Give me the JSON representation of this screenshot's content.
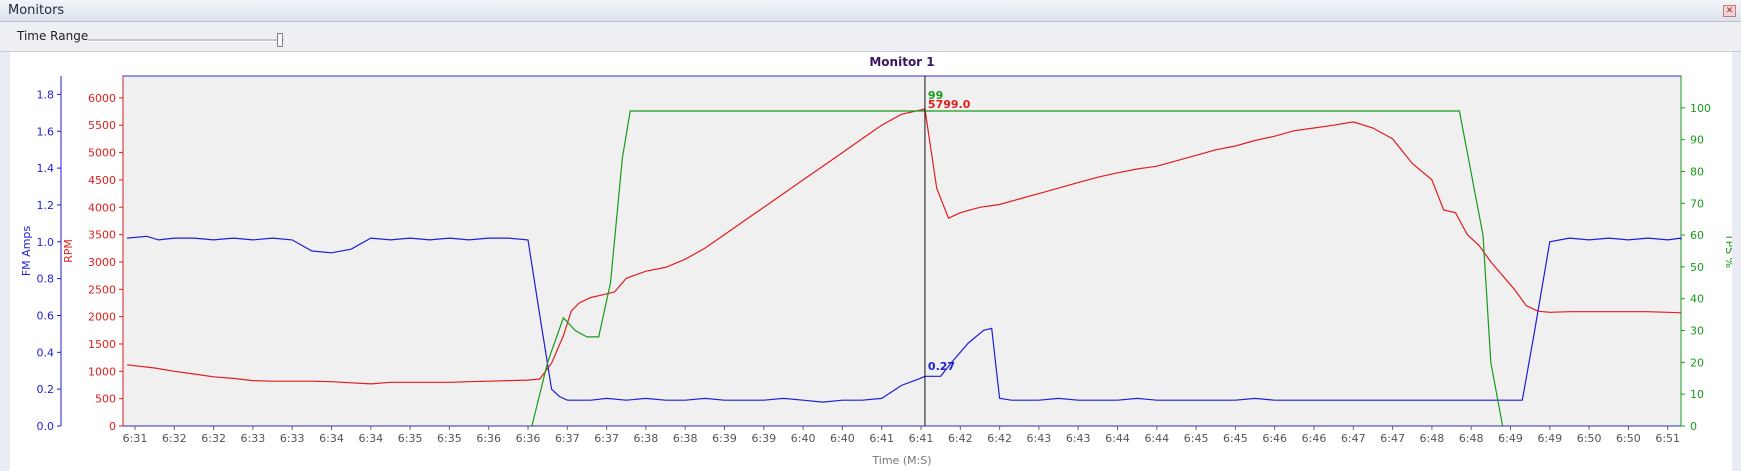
{
  "window": {
    "title": "Monitors",
    "close_icon": "close-icon"
  },
  "toolbar": {
    "time_range_label": "Time Range",
    "time_range_level": 1.0
  },
  "chart_data": {
    "type": "line",
    "title": "Monitor 1",
    "xlabel": "Time (M:S)",
    "x_ticks": [
      "6:31",
      "6:32",
      "6:32",
      "6:33",
      "6:33",
      "6:34",
      "6:34",
      "6:35",
      "6:35",
      "6:36",
      "6:36",
      "6:37",
      "6:37",
      "6:38",
      "6:38",
      "6:39",
      "6:39",
      "6:40",
      "6:40",
      "6:41",
      "6:41",
      "6:42",
      "6:42",
      "6:43",
      "6:43",
      "6:44",
      "6:44",
      "6:45",
      "6:45",
      "6:46",
      "6:46",
      "6:47",
      "6:47",
      "6:48",
      "6:48",
      "6:49",
      "6:49",
      "6:50",
      "6:50",
      "6:51"
    ],
    "grid": false,
    "axes": [
      {
        "id": "amps",
        "label": "FM Amps",
        "color": "#1f1fd6",
        "side": "left",
        "range": [
          0,
          1.9
        ],
        "ticks": [
          "0.0",
          "0.2",
          "0.4",
          "0.6",
          "0.8",
          "1.0",
          "1.2",
          "1.4",
          "1.6",
          "1.8"
        ]
      },
      {
        "id": "rpm",
        "label": "RPM",
        "color": "#e01e1e",
        "side": "left",
        "range": [
          0,
          6400
        ],
        "ticks": [
          "0",
          "500",
          "1000",
          "1500",
          "2000",
          "2500",
          "3000",
          "3500",
          "4000",
          "4500",
          "5000",
          "5500",
          "6000"
        ]
      },
      {
        "id": "tps",
        "label": "TPS %",
        "color": "#1a9a1a",
        "side": "right",
        "range": [
          0,
          110
        ],
        "ticks": [
          "0",
          "10",
          "20",
          "30",
          "40",
          "50",
          "60",
          "70",
          "80",
          "90",
          "100"
        ]
      }
    ],
    "cursor": {
      "x_tick_index": 20.1,
      "labels": [
        {
          "series": "TPS %",
          "text": "99",
          "color": "#1a9a1a"
        },
        {
          "series": "RPM",
          "text": "5799.0",
          "color": "#e01e1e"
        },
        {
          "series": "FM Amps",
          "text": "0.27",
          "color": "#1f1fd6"
        }
      ]
    },
    "series": [
      {
        "name": "RPM",
        "axis": "rpm",
        "color": "#e01e1e",
        "x": [
          -0.2,
          0.5,
          1,
          1.5,
          2,
          2.5,
          3,
          3.5,
          4,
          4.5,
          5,
          5.5,
          6,
          6.5,
          7,
          7.5,
          8,
          8.5,
          9,
          9.5,
          10,
          10.3,
          10.6,
          10.9,
          11.1,
          11.3,
          11.6,
          11.9,
          12.2,
          12.5,
          13,
          13.5,
          14,
          14.5,
          15,
          15.5,
          16,
          16.5,
          17,
          17.5,
          18,
          18.5,
          19,
          19.5,
          20,
          20.1,
          20.4,
          20.7,
          21,
          21.5,
          22,
          22.5,
          23,
          23.5,
          24,
          24.5,
          25,
          25.5,
          26,
          26.5,
          27,
          27.5,
          28,
          28.5,
          29,
          29.5,
          30,
          30.5,
          31,
          31.5,
          32,
          32.5,
          33,
          33.3,
          33.6,
          33.9,
          34.2,
          34.5,
          34.8,
          35.1,
          35.4,
          35.7,
          36,
          36.5,
          37,
          37.5,
          38,
          38.5,
          39,
          39.5,
          39.9
        ],
        "y": [
          1120,
          1060,
          1000,
          950,
          900,
          870,
          830,
          820,
          820,
          820,
          810,
          790,
          770,
          800,
          800,
          800,
          800,
          810,
          820,
          830,
          840,
          860,
          1150,
          1650,
          2100,
          2250,
          2350,
          2400,
          2450,
          2700,
          2830,
          2900,
          3050,
          3250,
          3500,
          3750,
          4000,
          4250,
          4500,
          4750,
          5000,
          5250,
          5500,
          5700,
          5780,
          5799,
          4350,
          3800,
          3900,
          4000,
          4050,
          4150,
          4250,
          4350,
          4450,
          4550,
          4630,
          4700,
          4750,
          4850,
          4950,
          5050,
          5120,
          5220,
          5300,
          5400,
          5450,
          5500,
          5560,
          5450,
          5250,
          4800,
          4500,
          3950,
          3900,
          3500,
          3300,
          3000,
          2750,
          2500,
          2200,
          2100,
          2080,
          2090,
          2090,
          2090,
          2090,
          2090,
          2080,
          2070,
          2070
        ]
      },
      {
        "name": "FM Amps",
        "axis": "amps",
        "color": "#1f1fd6",
        "x": [
          -0.2,
          0.3,
          0.6,
          1,
          1.5,
          2,
          2.5,
          3,
          3.5,
          4,
          4.5,
          5,
          5.5,
          6,
          6.5,
          7,
          7.5,
          8,
          8.5,
          9,
          9.5,
          10,
          10.3,
          10.6,
          10.8,
          11,
          11.3,
          11.6,
          12,
          12.5,
          13,
          13.5,
          14,
          14.5,
          15,
          15.5,
          16,
          16.5,
          17,
          17.5,
          18,
          18.5,
          19,
          19.5,
          20,
          20.1,
          20.5,
          20.8,
          21.2,
          21.6,
          21.8,
          22,
          22.3,
          22.6,
          23,
          23.5,
          24,
          24.5,
          25,
          25.5,
          26,
          26.5,
          27,
          27.5,
          28,
          28.5,
          29,
          29.5,
          30,
          30.5,
          31,
          31.5,
          32,
          32.5,
          33,
          33.3,
          33.6,
          33.9,
          34.2,
          34.5,
          34.8,
          35,
          35.3,
          35.6,
          36,
          36.5,
          37,
          37.5,
          38,
          38.5,
          39,
          39.5,
          39.9
        ],
        "y": [
          1.02,
          1.03,
          1.01,
          1.02,
          1.02,
          1.01,
          1.02,
          1.01,
          1.02,
          1.01,
          0.95,
          0.94,
          0.96,
          1.02,
          1.01,
          1.02,
          1.01,
          1.02,
          1.01,
          1.02,
          1.02,
          1.01,
          0.6,
          0.2,
          0.16,
          0.14,
          0.14,
          0.14,
          0.15,
          0.14,
          0.15,
          0.14,
          0.14,
          0.15,
          0.14,
          0.14,
          0.14,
          0.15,
          0.14,
          0.13,
          0.14,
          0.14,
          0.15,
          0.22,
          0.26,
          0.27,
          0.27,
          0.35,
          0.45,
          0.52,
          0.53,
          0.15,
          0.14,
          0.14,
          0.14,
          0.15,
          0.14,
          0.14,
          0.14,
          0.15,
          0.14,
          0.14,
          0.14,
          0.14,
          0.14,
          0.15,
          0.14,
          0.14,
          0.14,
          0.14,
          0.14,
          0.14,
          0.14,
          0.14,
          0.14,
          0.14,
          0.14,
          0.14,
          0.14,
          0.14,
          0.14,
          0.14,
          0.14,
          0.5,
          1.0,
          1.02,
          1.01,
          1.02,
          1.01,
          1.02,
          1.01,
          1.02,
          1.01
        ]
      },
      {
        "name": "TPS %",
        "axis": "tps",
        "color": "#1a9a1a",
        "x": [
          10.1,
          10.5,
          10.9,
          11.2,
          11.5,
          11.8,
          12.1,
          12.4,
          12.6,
          12.8,
          20.1,
          33.7,
          34.3,
          34.5,
          34.8
        ],
        "y": [
          0,
          20,
          34,
          30,
          28,
          28,
          45,
          84,
          99,
          99,
          99,
          99,
          60,
          20,
          0
        ]
      }
    ]
  }
}
